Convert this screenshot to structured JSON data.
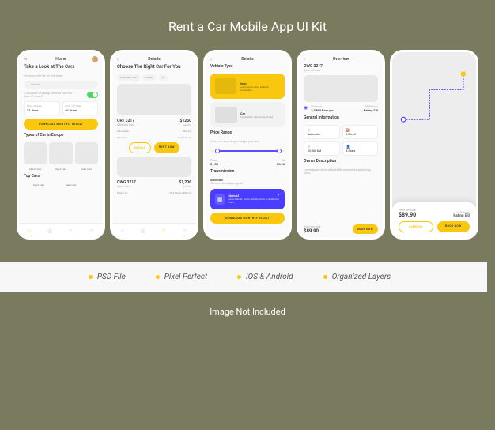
{
  "title": "Rent a Car Mobile App UI Kit",
  "accent": "#f9c80e",
  "screens": {
    "home": {
      "title": "Home",
      "heading": "Take a Look at The Cars",
      "subheading": "Find your best car for rent today",
      "search_placeholder": "Search",
      "toggle_label": "Is the place of pickup different from the place of return?",
      "pickup_label": "Pick - Up Date",
      "pickup_value": "22 June",
      "dropoff_label": "Drop - Off Date",
      "dropoff_value": "01 June",
      "cta": "DOWNLOAD MONTHLY RESULT",
      "section1": "Types of Car in Europe",
      "chips1": [
        "Cabrio Cars",
        "Sport Cars",
        "Jeep Cars"
      ],
      "section2": "Top Cars",
      "chips2": [
        "Sport Cars",
        "Jeep Cars"
      ]
    },
    "details1": {
      "title": "Details",
      "heading": "Choose The Right Car For You",
      "filters": [
        "Automatic Cars",
        "4 Seats",
        "All"
      ],
      "car1_name": "QRT 3217",
      "car1_type": "Cabriolet Cars",
      "car1_price": "$1250",
      "car1_per": "/per day",
      "spec1a": "Max Speed",
      "spec1b": "Max AC",
      "spec1c": "Max Gear",
      "spec1d": "Seater Score",
      "btn_details": "DETAILS",
      "btn_rent": "RENT NOW",
      "car2_name": "OWG 3217",
      "car2_type": "Sport Cars",
      "car2_price": "$1,206",
      "car2_per": "/per day",
      "spec2a": "Engine AC",
      "spec2b": "Max Speed 280km/h"
    },
    "details2": {
      "title": "Details",
      "heading": "Vehicle Type",
      "card1_title": "Jeep",
      "card1_desc": "Lorem ipsum dolor sit amet consectetur",
      "card2_title": "Car",
      "card2_desc": "Consectetur adipiscing elit sed",
      "range_heading": "Price Range",
      "range_sub": "Find a car according to budget you have",
      "price_from_label": "From",
      "price_from": "$1,50",
      "price_to_label": "To",
      "price_to": "$8,90",
      "trans_heading": "Transmission",
      "auto_label": "Automatic",
      "auto_desc": "Consectetur adipiscing elit",
      "manual_label": "Manual",
      "manual_desc": "Lacus blandit. Donec elementum in a vestibulum lorem.",
      "cta": "DOWNLOAD MONTHLY RESULT"
    },
    "overview": {
      "title": "Overview",
      "car_name": "OWG 3217",
      "car_type": "Sport All Cars",
      "distance_label": "Distance",
      "distance_value": "2,5 KM from you",
      "rating_label": "48 Ratings",
      "rating_value": "Rating 5.0",
      "gi_heading": "General Information",
      "gi": [
        {
          "icon": "⚙",
          "lbl": "Gearbox",
          "val": "Automatic"
        },
        {
          "icon": "⛽",
          "lbl": "Fuel",
          "val": "4 Diesel"
        },
        {
          "icon": "⟲",
          "lbl": "Distance",
          "val": "25,000 KM"
        },
        {
          "icon": "👤",
          "lbl": "Seats",
          "val": "4 Seats"
        }
      ],
      "owner_heading": "Owner Description",
      "owner_desc": "Lorem ipsum dolor sit amet elit consectetur adipiscing tortor",
      "price_label": "Price per hour",
      "price": "$89.90",
      "btn": "BOOK NOW"
    },
    "map": {
      "price_label": "Price per hour",
      "price": "$89.90",
      "rating_label": "24 Ratings",
      "rating_value": "Rating 5.0",
      "btn1": "OVERVIEW",
      "btn2": "BOOK NOW"
    }
  },
  "footer": {
    "items": [
      "PSD File",
      "Pixel Perfect",
      "iOS & Android",
      "Organized Layers"
    ]
  },
  "not_included": "Image Not Included"
}
